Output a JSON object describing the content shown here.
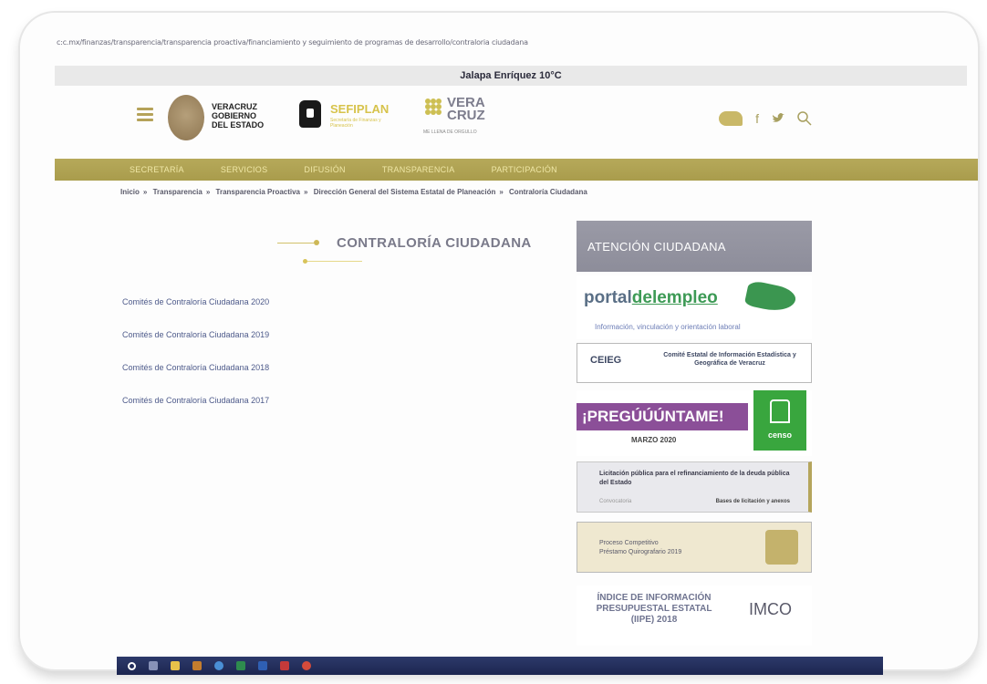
{
  "browser": {
    "url": "c:c.mx/finanzas/transparencia/transparencia proactiva/financiamiento y seguimiento de programas de desarrollo/contraloria ciudadana"
  },
  "weather": "Jalapa Enríquez 10°C",
  "header": {
    "gov_lines": [
      "VERACRUZ",
      "GOBIERNO",
      "DEL ESTADO"
    ],
    "sefiplan": "SEFIPLAN",
    "sefiplan_sub": "Secretaría de Finanzas y Planeación",
    "vc_lines": [
      "VERA",
      "CRUZ"
    ],
    "vc_sub": "ME LLENA DE ORGULLO",
    "icons": [
      "menu-icon",
      "chat-icon",
      "facebook-icon",
      "twitter-icon",
      "search-icon"
    ]
  },
  "nav": [
    "SECRETARÍA",
    "SERVICIOS",
    "DIFUSIÓN",
    "TRANSPARENCIA",
    "PARTICIPACIÓN"
  ],
  "breadcrumb": [
    "Inicio",
    "Transparencia",
    "Transparencia Proactiva",
    "Dirección General del Sistema Estatal de Planeación",
    "Contraloría Ciudadana"
  ],
  "main": {
    "title": "CONTRALORÍA CIUDADANA",
    "links": [
      "Comités de Contraloría Ciudadana 2020",
      "Comités de Contraloría Ciudadana 2019",
      "Comités de Contraloría Ciudadana 2018",
      "Comités de Contraloría Ciudadana 2017"
    ]
  },
  "sidebar": {
    "atencion": "ATENCIÓN CIUDADANA",
    "portal_a": "portal",
    "portal_b": "delempleo",
    "portal_sub": "Información, vinculación y orientación laboral",
    "ceieg_logo": "CEIEG",
    "ceieg_text": "Comité Estatal de Información Estadística y Geográfica de Veracruz",
    "pregunt_title": "¡PREGÚÚÚNTAME!",
    "pregunt_date": "MARZO 2020",
    "censo": "censo",
    "licit_title": "Licitación pública para el refinanciamiento de la deuda pública del Estado",
    "licit_left": "Convocatoria",
    "licit_right": "Bases de licitación y anexos",
    "proceso_lines": [
      "Proceso Competitivo",
      "Préstamo Quirografario 2019"
    ],
    "ipe_lines": [
      "ÍNDICE DE INFORMACIÓN",
      "PRESUPUESTAL ESTATAL",
      "(IIPE) 2018"
    ],
    "imco": "IMCO"
  },
  "colors": {
    "accent": "#b6a95a",
    "title": "#7a7a8a",
    "link": "#4d5a8a",
    "pregunt": "#8b4f98",
    "censo": "#39a63e"
  }
}
